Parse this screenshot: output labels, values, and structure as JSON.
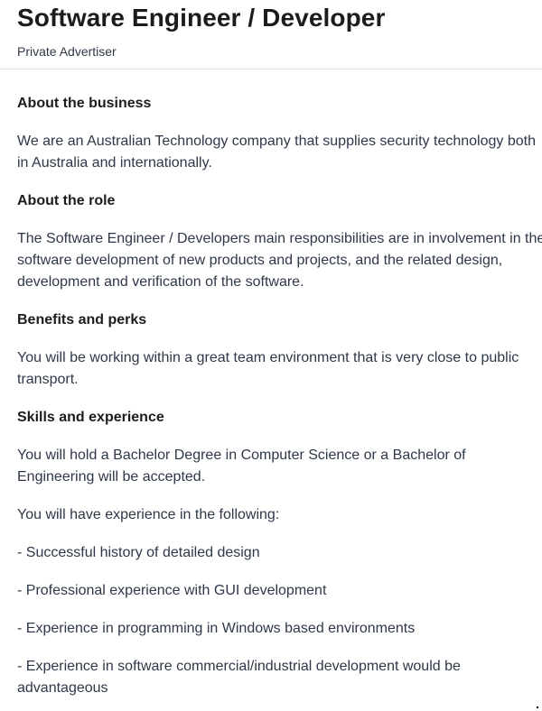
{
  "job": {
    "title": "Software Engineer / Developer",
    "advertiser": "Private Advertiser"
  },
  "sections": [
    {
      "heading": "About the business",
      "paragraphs": [
        "We are an Australian Technology company that supplies security technology both in Australia and internationally."
      ]
    },
    {
      "heading": "About the role",
      "paragraphs": [
        "The Software Engineer / Developers main responsibilities are in involvement in the software development of new products and projects, and the related design, development and verification of the software."
      ]
    },
    {
      "heading": "Benefits and perks",
      "paragraphs": [
        "You will be working within a great team environment that is very close to public transport."
      ]
    },
    {
      "heading": "Skills and experience",
      "paragraphs": [
        "You will hold a Bachelor Degree in Computer Science or a Bachelor of Engineering will be accepted.",
        "You will have experience in the following:",
        "- Successful history of detailed design",
        "- Professional experience with GUI development",
        "- Experience in programming in Windows based environments",
        "- Experience in software commercial/industrial development would be advantageous"
      ]
    }
  ]
}
